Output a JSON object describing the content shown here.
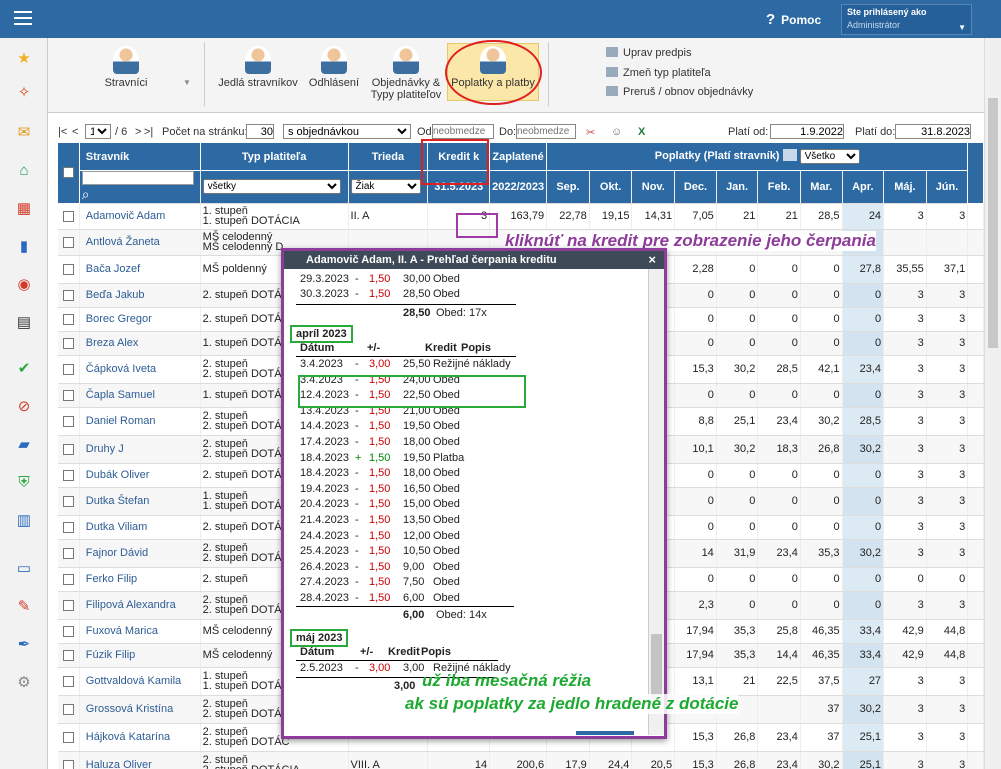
{
  "topbar": {
    "help_icon": "?",
    "help_label": "Pomoc",
    "user_label": "Ste prihlásený ako",
    "user_name": "Administrátor",
    "dropdown_icon": "▼"
  },
  "sidebar_icons": [
    "star-icon",
    "magic-wand-icon",
    "mail-icon",
    "home-icon",
    "calendar-grid-icon",
    "book-icon",
    "user-circle-icon",
    "calendar-icon",
    "check-circle-icon",
    "no-entry-icon",
    "briefcase-icon",
    "shield-icon",
    "bar-chart-icon",
    "open-book-icon",
    "chat-icon",
    "feather-icon",
    "gear-icon"
  ],
  "toolbar": {
    "stravnici": "Stravníci",
    "stravnici_arrow": "▼",
    "jedla": "Jedlá stravníkov",
    "odhlaseni": "Odhlásení",
    "objednavky_1": "Objednávky &",
    "objednavky_2": "Typy platiteľov",
    "poplatky": "Poplatky a platby",
    "uprav": "Uprav predpis",
    "zmen": "Zmeň typ platiteľa",
    "prerus": "Preruš / obnov objednávky"
  },
  "pager": {
    "first": "|<",
    "prev": "<",
    "page": "1",
    "of": "/ 6",
    "next": ">",
    "last": ">|",
    "per_page_label": "Počet na stránku:",
    "per_page": "30",
    "filter": "s objednávkou",
    "od_label": "Od:",
    "od_placeholder": "neobmedze",
    "do_label": "Do:",
    "do_placeholder": "neobmedze",
    "plati_od_label": "Platí od:",
    "plati_od": "1.9.2022",
    "plati_do_label": "Platí do:",
    "plati_do": "31.8.2023"
  },
  "table": {
    "headers": {
      "stravnik": "Stravník",
      "typ": "Typ platiteľa",
      "trieda": "Trieda",
      "kredit": "Kredit k",
      "kredit_date": "31.5.2023",
      "zaplatene": "Zaplatené",
      "zaplatene_year": "2022/2023",
      "poplatky": "Poplatky (Platí stravník)",
      "poplatky_filter": "Všetko",
      "months": [
        "Sep.",
        "Okt.",
        "Nov.",
        "Dec.",
        "Jan.",
        "Feb.",
        "Mar.",
        "Apr.",
        "Máj.",
        "Jún."
      ]
    },
    "filters": {
      "typ": "všetky",
      "trieda": "Žiak"
    },
    "rows": [
      {
        "name": "Adamovič Adam",
        "typ1": "1. stupeň",
        "typ2": "1. stupeň DOTÁCIA",
        "trieda": "II. A",
        "kredit": "3",
        "zapl": "163,79",
        "m": [
          "22,78",
          "19,15",
          "14,31",
          "7,05",
          "21",
          "21",
          "28,5",
          "24",
          "3",
          "3"
        ]
      },
      {
        "name": "Antlová Žaneta",
        "typ1": "MŠ celodenný",
        "typ2": "MŠ celodenný D",
        "trieda": "",
        "kredit": "",
        "zapl": "",
        "m": [
          "",
          "",
          "",
          "",
          "",
          "",
          "",
          "",
          "",
          ""
        ]
      },
      {
        "name": "Bača Jozef",
        "typ1": "MŠ poldenný",
        "typ2": "",
        "trieda": "",
        "kredit": "",
        "zapl": "",
        "m": [
          "",
          "",
          "",
          "2,28",
          "0",
          "0",
          "0",
          "27,8",
          "35,55",
          "37,1"
        ]
      },
      {
        "name": "Beďa Jakub",
        "typ1": "2. stupeň DOTÁC",
        "typ2": "",
        "trieda": "",
        "kredit": "",
        "zapl": "",
        "m": [
          "",
          "",
          "",
          "0",
          "0",
          "0",
          "0",
          "0",
          "3",
          "3"
        ]
      },
      {
        "name": "Borec Gregor",
        "typ1": "2. stupeň DOTÁC",
        "typ2": "",
        "trieda": "",
        "kredit": "",
        "zapl": "",
        "m": [
          "",
          "",
          "",
          "0",
          "0",
          "0",
          "0",
          "0",
          "3",
          "3"
        ]
      },
      {
        "name": "Breza Alex",
        "typ1": "1. stupeň DOTÁC",
        "typ2": "",
        "trieda": "",
        "kredit": "",
        "zapl": "",
        "m": [
          "",
          "",
          "",
          "0",
          "0",
          "0",
          "0",
          "0",
          "3",
          "3"
        ]
      },
      {
        "name": "Čápková Iveta",
        "typ1": "2. stupeň",
        "typ2": "2. stupeň DOTÁC",
        "trieda": "",
        "kredit": "",
        "zapl": "",
        "m": [
          "",
          "",
          "",
          "15,3",
          "30,2",
          "28,5",
          "42,1",
          "23,4",
          "3",
          "3"
        ]
      },
      {
        "name": "Čapla Samuel",
        "typ1": "1. stupeň DOTÁC",
        "typ2": "",
        "trieda": "",
        "kredit": "",
        "zapl": "",
        "m": [
          "",
          "",
          "",
          "0",
          "0",
          "0",
          "0",
          "0",
          "3",
          "3"
        ]
      },
      {
        "name": "Daniel Roman",
        "typ1": "2. stupeň",
        "typ2": "2. stupeň DOTÁC",
        "trieda": "",
        "kredit": "",
        "zapl": "",
        "m": [
          "",
          "",
          "",
          "8,8",
          "25,1",
          "23,4",
          "30,2",
          "28,5",
          "3",
          "3"
        ]
      },
      {
        "name": "Druhy J",
        "typ1": "2. stupeň",
        "typ2": "2. stupeň DOTÁC",
        "trieda": "",
        "kredit": "",
        "zapl": "",
        "m": [
          "",
          "",
          "",
          "10,1",
          "30,2",
          "18,3",
          "26,8",
          "30,2",
          "3",
          "3"
        ]
      },
      {
        "name": "Dubák Oliver",
        "typ1": "2. stupeň DOTÁC",
        "typ2": "",
        "trieda": "",
        "kredit": "",
        "zapl": "",
        "m": [
          "",
          "",
          "",
          "0",
          "0",
          "0",
          "0",
          "0",
          "3",
          "3"
        ]
      },
      {
        "name": "Dutka Štefan",
        "typ1": "1. stupeň",
        "typ2": "1. stupeň DOTÁC",
        "trieda": "",
        "kredit": "",
        "zapl": "",
        "m": [
          "",
          "",
          "",
          "0",
          "0",
          "0",
          "0",
          "0",
          "3",
          "3"
        ]
      },
      {
        "name": "Dutka Viliam",
        "typ1": "2. stupeň DOTÁC",
        "typ2": "",
        "trieda": "",
        "kredit": "",
        "zapl": "",
        "m": [
          "",
          "",
          "",
          "0",
          "0",
          "0",
          "0",
          "0",
          "3",
          "3"
        ]
      },
      {
        "name": "Fajnor Dávid",
        "typ1": "2. stupeň",
        "typ2": "2. stupeň DOTÁC",
        "trieda": "",
        "kredit": "",
        "zapl": "",
        "m": [
          "",
          "",
          "",
          "14",
          "31,9",
          "23,4",
          "35,3",
          "30,2",
          "3",
          "3"
        ]
      },
      {
        "name": "Ferko Filip",
        "typ1": "2. stupeň",
        "typ2": "",
        "trieda": "",
        "kredit": "",
        "zapl": "",
        "m": [
          "",
          "",
          "",
          "0",
          "0",
          "0",
          "0",
          "0",
          "0",
          "0"
        ]
      },
      {
        "name": "Filipová Alexandra",
        "typ1": "2. stupeň",
        "typ2": "2. stupeň DOTÁC",
        "trieda": "",
        "kredit": "",
        "zapl": "",
        "m": [
          "",
          "",
          "",
          "2,3",
          "0",
          "0",
          "0",
          "0",
          "3",
          "3"
        ]
      },
      {
        "name": "Fuxová Marica",
        "typ1": "MŠ celodenný",
        "typ2": "",
        "trieda": "",
        "kredit": "",
        "zapl": "",
        "m": [
          "",
          "",
          "",
          "17,94",
          "35,3",
          "25,8",
          "46,35",
          "33,4",
          "42,9",
          "44,8"
        ]
      },
      {
        "name": "Fúzik Filip",
        "typ1": "MŠ celodenný",
        "typ2": "",
        "trieda": "",
        "kredit": "",
        "zapl": "",
        "m": [
          "",
          "",
          "",
          "17,94",
          "35,3",
          "14,4",
          "46,35",
          "33,4",
          "42,9",
          "44,8"
        ]
      },
      {
        "name": "Gottvaldová Kamila",
        "typ1": "1. stupeň",
        "typ2": "1. stupeň DOTÁCIA",
        "trieda": "",
        "kredit": "",
        "zapl": "",
        "m": [
          "",
          "",
          "",
          "13,1",
          "21",
          "22,5",
          "37,5",
          "27",
          "3",
          "3"
        ]
      },
      {
        "name": "Grossová Kristína",
        "typ1": "2. stupeň",
        "typ2": "2. stupeň DOTÁC",
        "trieda": "",
        "kredit": "",
        "zapl": "",
        "m": [
          "",
          "",
          "",
          "",
          "",
          "",
          "37",
          "30,2",
          "3",
          "3"
        ]
      },
      {
        "name": "Hájková Katarína",
        "typ1": "2. stupeň",
        "typ2": "2. stupeň DOTÁC",
        "trieda": "",
        "kredit": "",
        "zapl": "",
        "m": [
          "",
          "",
          "",
          "15,3",
          "26,8",
          "23,4",
          "37",
          "25,1",
          "3",
          "3"
        ]
      },
      {
        "name": "Haluza Oliver",
        "typ1": "2. stupeň",
        "typ2": "2. stupeň DOTÁCIA",
        "trieda": "VIII. A",
        "kredit": "14",
        "zapl": "200,6",
        "m": [
          "17,9",
          "24,4",
          "20,5",
          "15,3",
          "26,8",
          "23,4",
          "30,2",
          "25,1",
          "3",
          "3"
        ]
      }
    ]
  },
  "popup": {
    "title": "Adamovič Adam,  II. A - Prehľad čerpania kreditu",
    "close": "×",
    "march_rows": [
      {
        "date": "29.3.2023",
        "sign": "-",
        "amt": "1,50",
        "bal": "30,00",
        "desc": "Obed"
      },
      {
        "date": "30.3.2023",
        "sign": "-",
        "amt": "1,50",
        "bal": "28,50",
        "desc": "Obed"
      }
    ],
    "march_total": "28,50",
    "march_summary": "Obed: 17x",
    "april_head": "apríl 2023",
    "col_datum": "Dátum",
    "col_pm": "+/-",
    "col_kredit": "Kredit",
    "col_popis": "Popis",
    "april_rows": [
      {
        "date": "3.4.2023",
        "sign": "-",
        "amt": "3,00",
        "bal": "25,50",
        "desc": "Režijné náklady"
      },
      {
        "date": "3.4.2023",
        "sign": "-",
        "amt": "1,50",
        "bal": "24,00",
        "desc": "Obed"
      },
      {
        "date": "12.4.2023",
        "sign": "-",
        "amt": "1,50",
        "bal": "22,50",
        "desc": "Obed"
      },
      {
        "date": "13.4.2023",
        "sign": "-",
        "amt": "1,50",
        "bal": "21,00",
        "desc": "Obed"
      },
      {
        "date": "14.4.2023",
        "sign": "-",
        "amt": "1,50",
        "bal": "19,50",
        "desc": "Obed"
      },
      {
        "date": "17.4.2023",
        "sign": "-",
        "amt": "1,50",
        "bal": "18,00",
        "desc": "Obed"
      },
      {
        "date": "18.4.2023",
        "sign": "+",
        "amt": "1,50",
        "bal": "19,50",
        "desc": "Platba"
      },
      {
        "date": "18.4.2023",
        "sign": "-",
        "amt": "1,50",
        "bal": "18,00",
        "desc": "Obed"
      },
      {
        "date": "19.4.2023",
        "sign": "-",
        "amt": "1,50",
        "bal": "16,50",
        "desc": "Obed"
      },
      {
        "date": "20.4.2023",
        "sign": "-",
        "amt": "1,50",
        "bal": "15,00",
        "desc": "Obed"
      },
      {
        "date": "21.4.2023",
        "sign": "-",
        "amt": "1,50",
        "bal": "13,50",
        "desc": "Obed"
      },
      {
        "date": "24.4.2023",
        "sign": "-",
        "amt": "1,50",
        "bal": "12,00",
        "desc": "Obed"
      },
      {
        "date": "25.4.2023",
        "sign": "-",
        "amt": "1,50",
        "bal": "10,50",
        "desc": "Obed"
      },
      {
        "date": "26.4.2023",
        "sign": "-",
        "amt": "1,50",
        "bal": "9,00",
        "desc": "Obed"
      },
      {
        "date": "27.4.2023",
        "sign": "-",
        "amt": "1,50",
        "bal": "7,50",
        "desc": "Obed"
      },
      {
        "date": "28.4.2023",
        "sign": "-",
        "amt": "1,50",
        "bal": "6,00",
        "desc": "Obed"
      }
    ],
    "april_total": "6,00",
    "april_summary": "Obed: 14x",
    "may_head": "máj 2023",
    "may_rows": [
      {
        "date": "2.5.2023",
        "sign": "-",
        "amt": "3,00",
        "bal": "3,00",
        "desc": "Režijné náklady"
      }
    ],
    "may_total": "3,00"
  },
  "annotations": {
    "a1": "kliknúť na kredit pre zobrazenie jeho čerpania",
    "a2": "už iba mesačná réžia",
    "a3": "ak sú poplatky za jedlo hradené z dotácie"
  }
}
